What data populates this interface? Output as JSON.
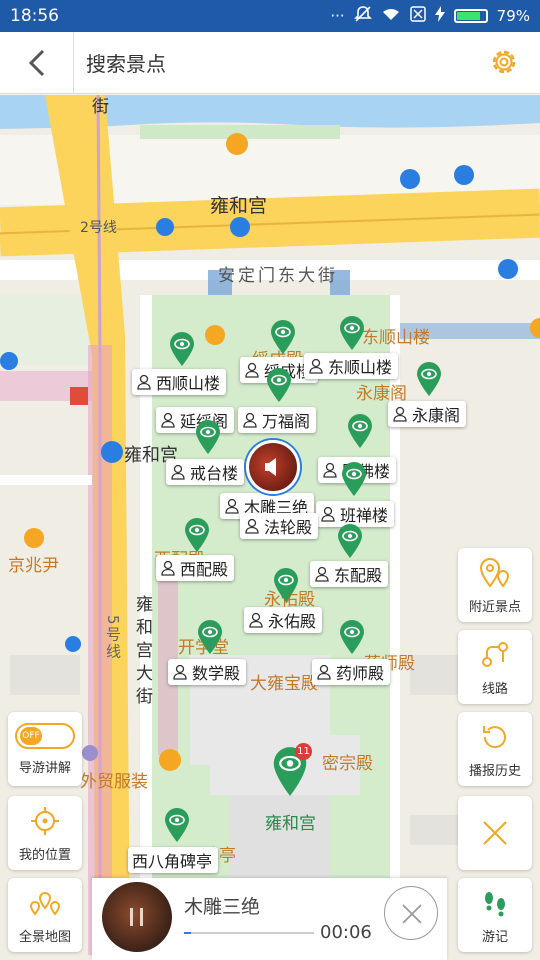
{
  "status": {
    "time": "18:56",
    "dots": "···",
    "battery": "79%",
    "battery_level": 0.79
  },
  "header": {
    "title": "搜索景点"
  },
  "map": {
    "labels": {
      "jie": "街",
      "yonghegong_top": "雍和宫",
      "line2": "2号线",
      "andingmen": "安定门东大街",
      "yonghe_left": "雍和宫",
      "jingzhaoyin": "京兆尹",
      "line5": "5号线",
      "yonghegong_street": "雍和宫大街",
      "waimao": "外贸服装",
      "yonghegong_bottom": "雍和宫",
      "mizongdian": "密宗殿",
      "dongshunshanlou_map": "东顺山楼",
      "yongkangge_map": "永康阁",
      "xipeidian_map": "西配殿",
      "yongyoudian_map": "永佑殿",
      "yaoshidian_map": "药师殿",
      "kaixuetang": "开学堂",
      "dalongbaodian": "大雍宝殿",
      "beiting": "碑亭",
      "suichengdian_map": "绥成殿"
    },
    "pois": [
      {
        "name": "西顺山楼"
      },
      {
        "name": "绥成楼"
      },
      {
        "name": "东顺山楼"
      },
      {
        "name": "延绥阁"
      },
      {
        "name": "万福阁"
      },
      {
        "name": "永康阁"
      },
      {
        "name": "戒台楼"
      },
      {
        "name": "照佛楼"
      },
      {
        "name": "班禅楼"
      },
      {
        "name": "木雕三绝"
      },
      {
        "name": "法轮殿"
      },
      {
        "name": "西配殿"
      },
      {
        "name": "东配殿"
      },
      {
        "name": "永佑殿"
      },
      {
        "name": "数学殿"
      },
      {
        "name": "药师殿"
      },
      {
        "name": "西八角碑亭"
      }
    ],
    "cluster_count": "11"
  },
  "side_buttons": {
    "nearby": "附近景点",
    "route": "线路",
    "history": "播报历史",
    "close": "",
    "youji": "游记",
    "guide": "导游讲解",
    "guide_toggle": "OFF",
    "location": "我的位置",
    "fullmap": "全景地图"
  },
  "player": {
    "title": "木雕三绝",
    "time": "00:06",
    "progress": 0.05
  },
  "colors": {
    "green": "#2a9d5a",
    "blue": "#1e5aa8",
    "orange": "#f5a623"
  }
}
